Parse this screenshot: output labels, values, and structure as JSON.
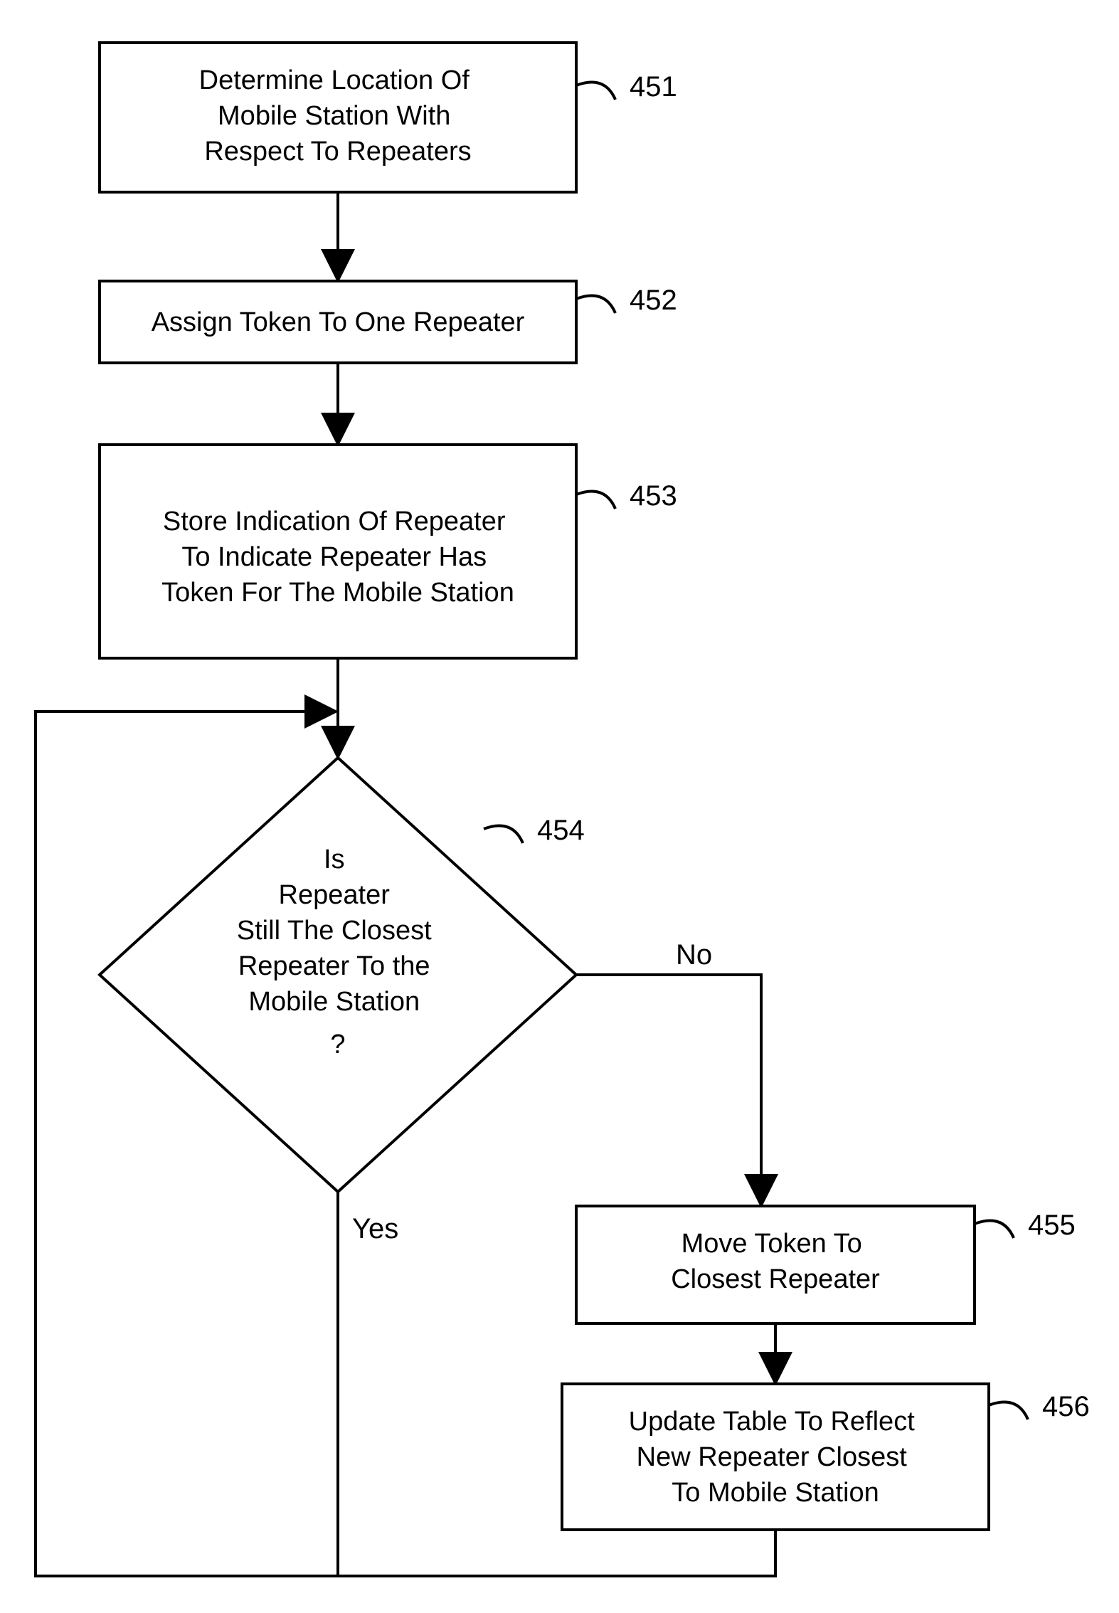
{
  "nodes": {
    "n451": {
      "ref": "451",
      "lines": [
        "Determine Location Of",
        "Mobile Station With",
        "Respect To Repeaters"
      ]
    },
    "n452": {
      "ref": "452",
      "lines": [
        "Assign Token To One Repeater"
      ]
    },
    "n453": {
      "ref": "453",
      "lines": [
        "Store Indication Of Repeater",
        "To Indicate Repeater Has",
        "Token For The Mobile Station"
      ]
    },
    "n454": {
      "ref": "454",
      "lines": [
        "Is",
        "Repeater",
        "Still The Closest",
        "Repeater To the",
        "Mobile Station",
        "?"
      ]
    },
    "n455": {
      "ref": "455",
      "lines": [
        "Move Token To",
        "Closest Repeater"
      ]
    },
    "n456": {
      "ref": "456",
      "lines": [
        "Update Table To Reflect",
        "New Repeater Closest",
        "To Mobile Station"
      ]
    }
  },
  "edges": {
    "yes": "Yes",
    "no": "No"
  }
}
